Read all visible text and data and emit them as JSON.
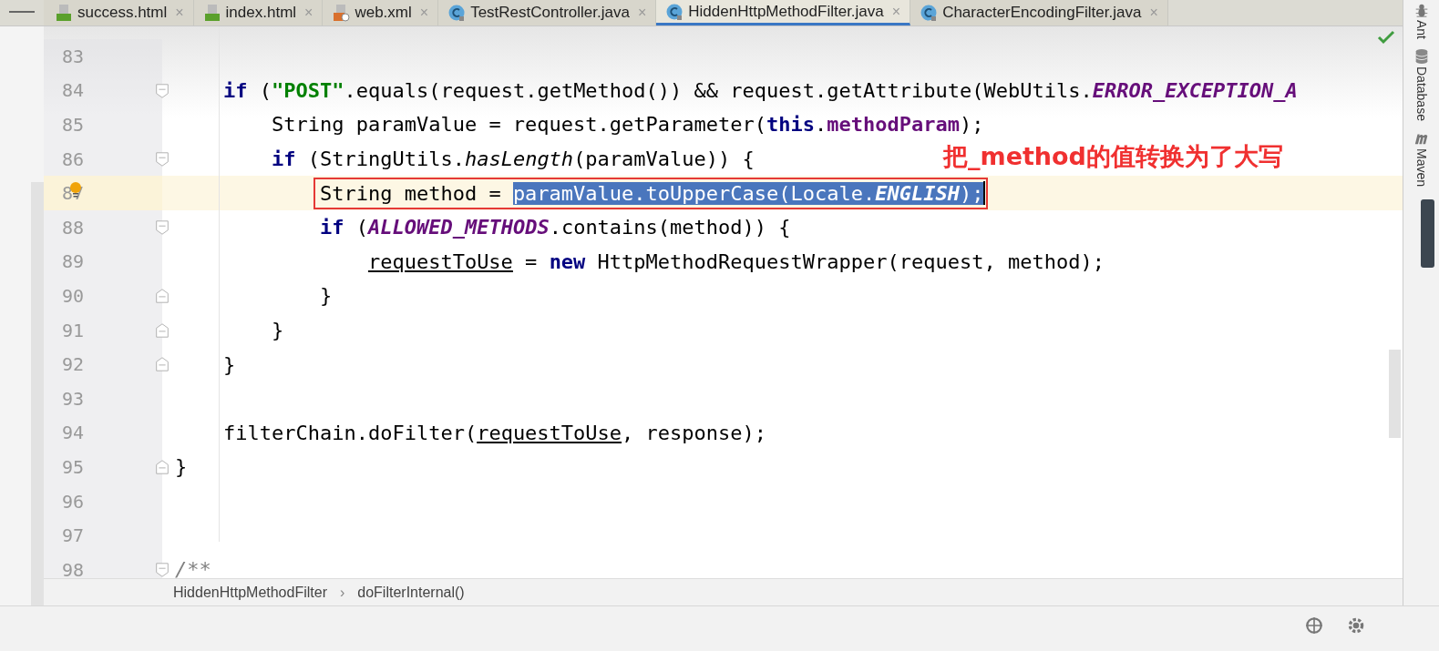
{
  "tabs": [
    {
      "label": "success.html",
      "kind": "html",
      "close": "×",
      "selected": false
    },
    {
      "label": "index.html",
      "kind": "html",
      "close": "×",
      "selected": false
    },
    {
      "label": "web.xml",
      "kind": "xml",
      "close": "×",
      "selected": false
    },
    {
      "label": "TestRestController.java",
      "kind": "class",
      "close": "×",
      "selected": false
    },
    {
      "label": "HiddenHttpMethodFilter.java",
      "kind": "class",
      "close": "×",
      "selected": true
    },
    {
      "label": "CharacterEncodingFilter.java",
      "kind": "class",
      "close": "×",
      "selected": false
    }
  ],
  "editor": {
    "lines": [
      {
        "number": "83",
        "fold_start": false,
        "fold_end": false,
        "current": false,
        "bulb": false,
        "boxed": false
      },
      {
        "number": "84",
        "fold_start": true,
        "fold_end": false,
        "current": false,
        "bulb": false,
        "boxed": false,
        "tokens": [
          {
            "text": "    if",
            "kind": "keyword"
          },
          {
            "text": " (",
            "kind": "plain"
          },
          {
            "text": "\"POST\"",
            "kind": "string"
          },
          {
            "text": ".equals(request.getMethod()) && request.getAttribute(WebUtils.",
            "kind": "plain"
          },
          {
            "text": "ERROR_EXCEPTION_A",
            "kind": "constant"
          }
        ]
      },
      {
        "number": "85",
        "fold_start": false,
        "fold_end": false,
        "current": false,
        "bulb": false,
        "boxed": false,
        "tokens": [
          {
            "text": "        String paramValue = request.getParameter(",
            "kind": "plain"
          },
          {
            "text": "this",
            "kind": "keyword"
          },
          {
            "text": ".",
            "kind": "plain"
          },
          {
            "text": "methodParam",
            "kind": "field"
          },
          {
            "text": ");",
            "kind": "plain"
          }
        ]
      },
      {
        "number": "86",
        "fold_start": true,
        "fold_end": false,
        "current": false,
        "bulb": false,
        "boxed": false,
        "tokens": [
          {
            "text": "        if",
            "kind": "keyword"
          },
          {
            "text": " (StringUtils.",
            "kind": "plain"
          },
          {
            "text": "hasLength",
            "kind": "static-call"
          },
          {
            "text": "(paramValue)) {",
            "kind": "plain"
          }
        ]
      },
      {
        "number": "87",
        "fold_start": false,
        "fold_end": false,
        "current": true,
        "bulb": true,
        "boxed": true,
        "tokens": [
          {
            "text": "            String method = ",
            "kind": "plain",
            "selected": false
          },
          {
            "text": "paramValue.toUpperCase(Locale.",
            "kind": "plain",
            "selected": true
          },
          {
            "text": "ENGLISH",
            "kind": "constant",
            "selected": true
          },
          {
            "text": ");",
            "kind": "plain",
            "selected": true
          }
        ]
      },
      {
        "number": "88",
        "fold_start": true,
        "fold_end": false,
        "current": false,
        "bulb": false,
        "boxed": false,
        "tokens": [
          {
            "text": "            if",
            "kind": "keyword"
          },
          {
            "text": " (",
            "kind": "plain"
          },
          {
            "text": "ALLOWED_METHODS",
            "kind": "constant"
          },
          {
            "text": ".contains(method)) {",
            "kind": "plain"
          }
        ]
      },
      {
        "number": "89",
        "fold_start": false,
        "fold_end": false,
        "current": false,
        "bulb": false,
        "boxed": false,
        "tokens": [
          {
            "text": "                requestToUse",
            "kind": "reassigned"
          },
          {
            "text": " = ",
            "kind": "plain"
          },
          {
            "text": "new",
            "kind": "keyword"
          },
          {
            "text": " HttpMethodRequestWrapper(request, method);",
            "kind": "plain"
          }
        ]
      },
      {
        "number": "90",
        "fold_start": false,
        "fold_end": true,
        "current": false,
        "bulb": false,
        "boxed": false,
        "tokens": [
          {
            "text": "            }",
            "kind": "plain"
          }
        ]
      },
      {
        "number": "91",
        "fold_start": false,
        "fold_end": true,
        "current": false,
        "bulb": false,
        "boxed": false,
        "tokens": [
          {
            "text": "        }",
            "kind": "plain"
          }
        ]
      },
      {
        "number": "92",
        "fold_start": false,
        "fold_end": true,
        "current": false,
        "bulb": false,
        "boxed": false,
        "tokens": [
          {
            "text": "    }",
            "kind": "plain"
          }
        ]
      },
      {
        "number": "93",
        "fold_start": false,
        "fold_end": false,
        "current": false,
        "bulb": false,
        "boxed": false
      },
      {
        "number": "94",
        "fold_start": false,
        "fold_end": false,
        "current": false,
        "bulb": false,
        "boxed": false,
        "tokens": [
          {
            "text": "    filterChain.doFilter(",
            "kind": "plain"
          },
          {
            "text": "requestToUse",
            "kind": "reassigned"
          },
          {
            "text": ", response);",
            "kind": "plain"
          }
        ]
      },
      {
        "number": "95",
        "fold_start": false,
        "fold_end": true,
        "current": false,
        "bulb": false,
        "boxed": false,
        "tokens": [
          {
            "text": "}",
            "kind": "plain"
          }
        ]
      },
      {
        "number": "96",
        "fold_start": false,
        "fold_end": false,
        "current": false,
        "bulb": false,
        "boxed": false
      },
      {
        "number": "97",
        "fold_start": false,
        "fold_end": false,
        "current": false,
        "bulb": false,
        "boxed": false
      },
      {
        "number": "98",
        "fold_start": true,
        "fold_end": false,
        "current": false,
        "bulb": false,
        "boxed": false,
        "tokens": [
          {
            "text": "/**",
            "kind": "comment"
          }
        ]
      }
    ],
    "annotation": "把_method的值转换为了大写"
  },
  "breadcrumbs": [
    "HiddenHttpMethodFilter",
    "doFilterInternal()"
  ],
  "breadcrumb_separator": "›",
  "tool_windows": [
    {
      "label": "Ant",
      "kind": "ant"
    },
    {
      "label": "Database",
      "kind": "database"
    },
    {
      "label": "Maven",
      "kind": "maven"
    }
  ]
}
